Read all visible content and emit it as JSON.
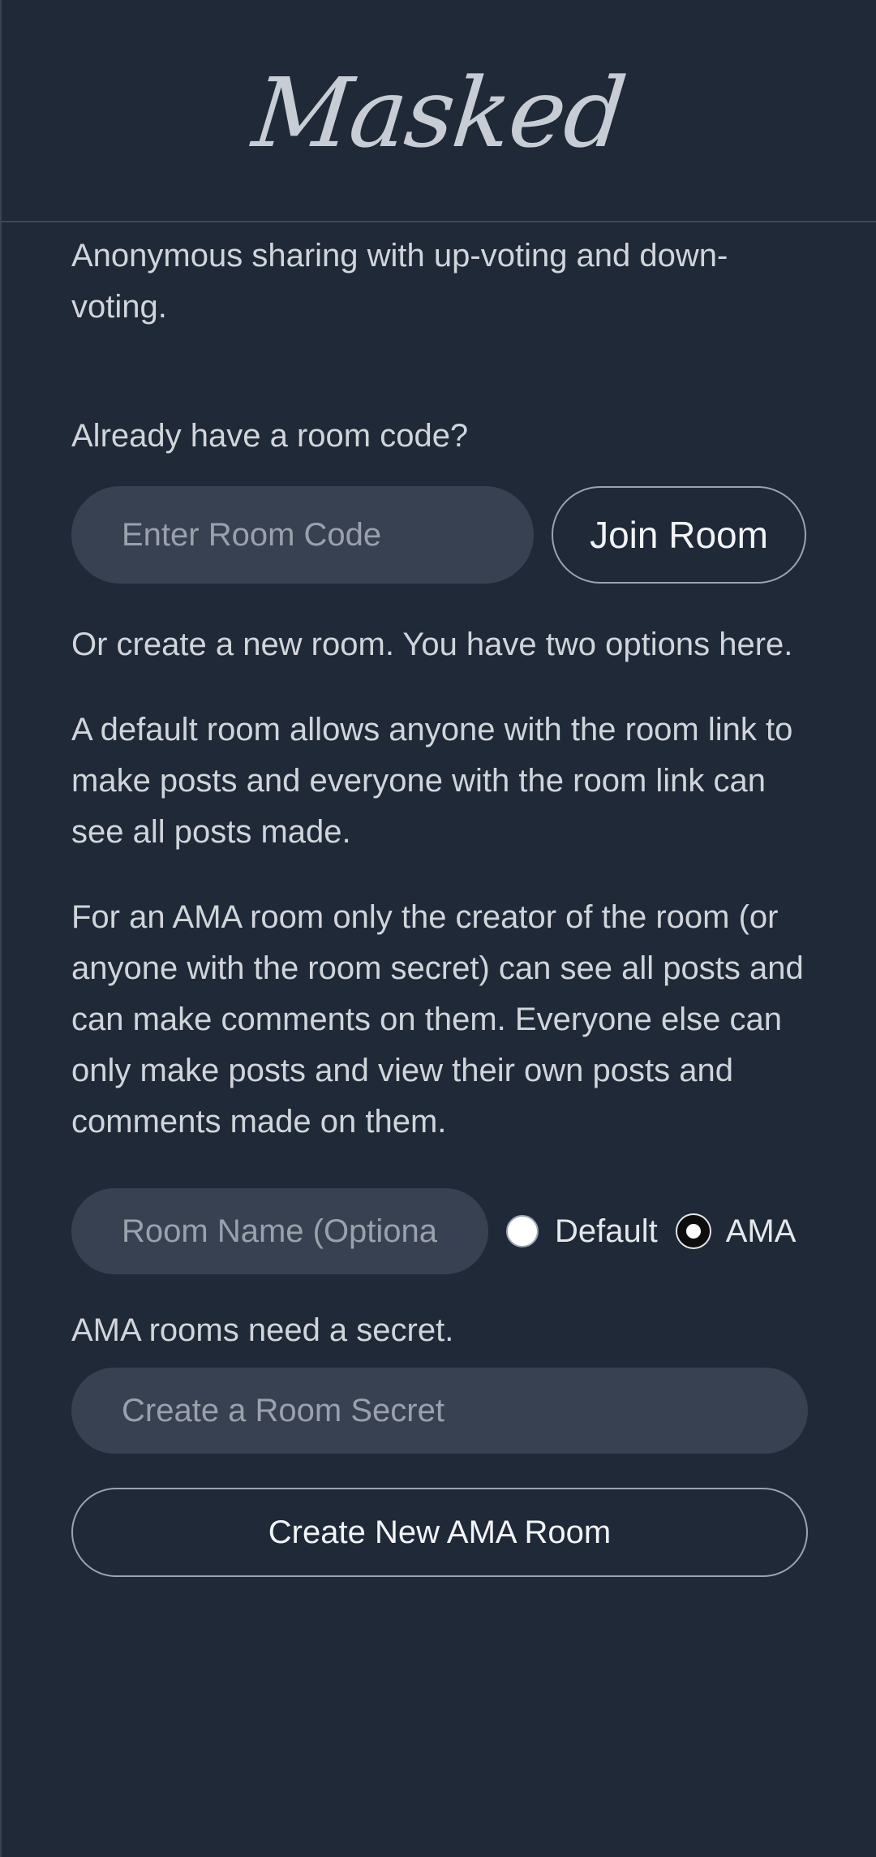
{
  "header": {
    "logo": "Masked"
  },
  "intro": {
    "tagline": "Anonymous sharing with up-voting and down-voting."
  },
  "join": {
    "prompt": "Already have a room code?",
    "room_code_placeholder": "Enter Room Code",
    "join_label": "Join Room"
  },
  "create": {
    "intro": "Or create a new room. You have two options here.",
    "default_description": "A default room allows anyone with the room link to make posts and everyone with the room link can see all posts made.",
    "ama_description": "For an AMA room only the creator of the room (or anyone with the room secret) can see all posts and can make comments on them. Everyone else can only make posts and view their own posts and comments made on them.",
    "room_name_placeholder": "Room Name (Optional)",
    "room_type_options": [
      "Default",
      "AMA"
    ],
    "room_type_selected": "AMA",
    "secret_note": "AMA rooms need a secret.",
    "secret_placeholder": "Create a Room Secret",
    "create_label": "Create New AMA Room"
  }
}
